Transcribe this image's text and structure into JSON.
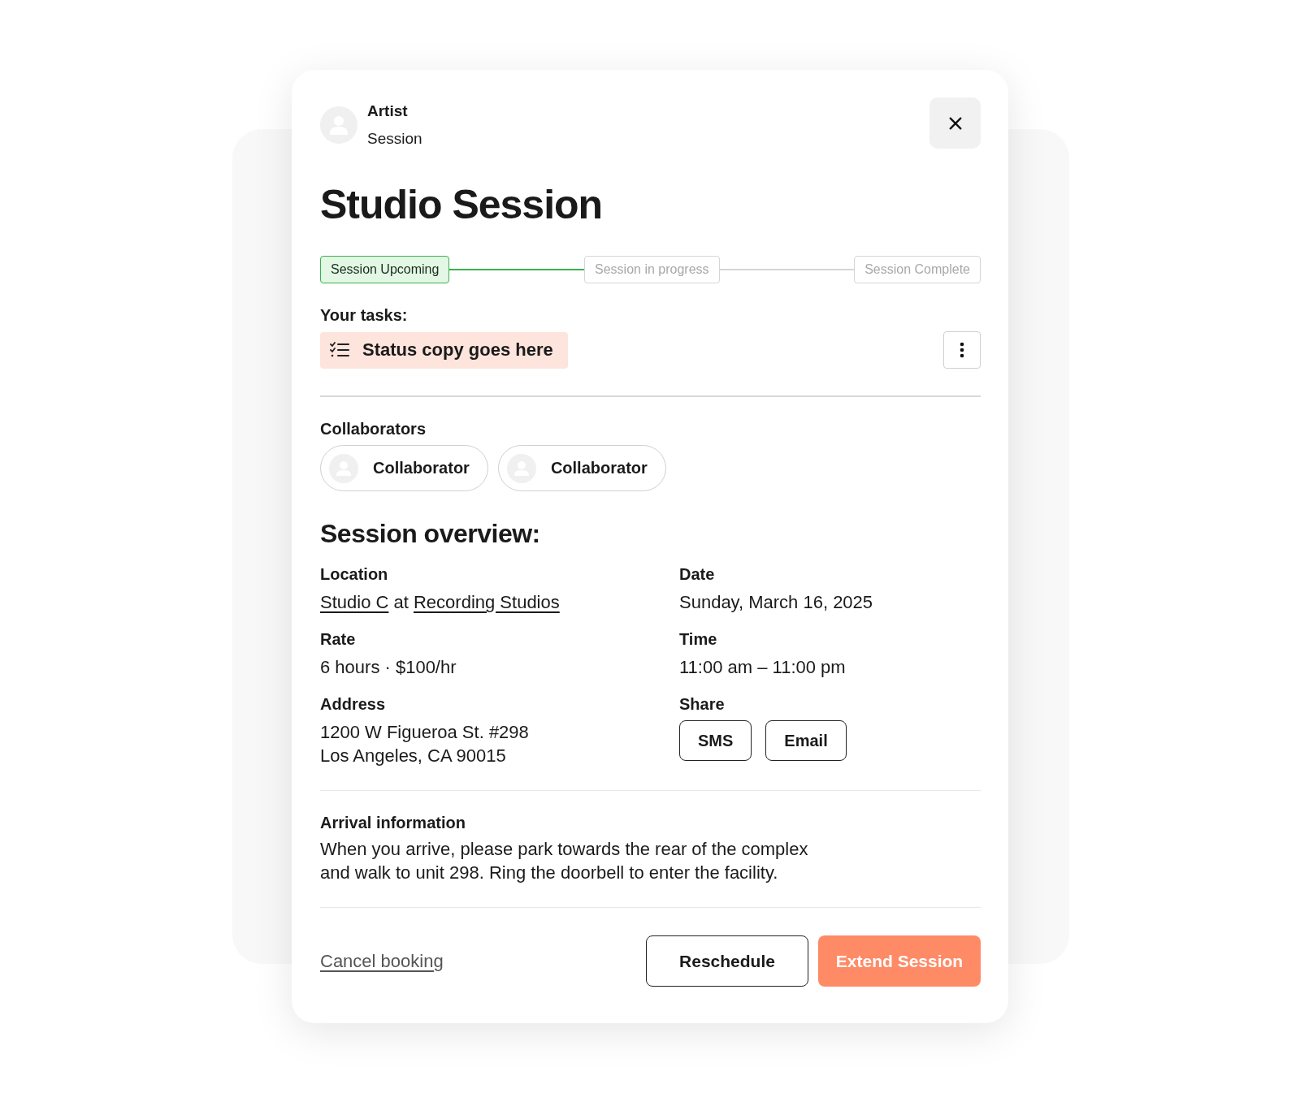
{
  "header": {
    "name": "Artist",
    "subtitle": "Session"
  },
  "title": "Studio Session",
  "steps": [
    {
      "label": "Session Upcoming",
      "active": true
    },
    {
      "label": "Session in progress",
      "active": false
    },
    {
      "label": "Session Complete",
      "active": false
    }
  ],
  "tasks": {
    "label": "Your tasks:",
    "status": "Status copy goes here"
  },
  "collaborators": {
    "label": "Collaborators",
    "items": [
      {
        "name": "Collaborator"
      },
      {
        "name": "Collaborator"
      }
    ]
  },
  "overview": {
    "title": "Session overview:",
    "location": {
      "label": "Location",
      "parts": [
        {
          "kind": "link",
          "text": "Studio C"
        },
        {
          "kind": "text",
          "text": " at "
        },
        {
          "kind": "link",
          "text": "Recording Studios"
        }
      ]
    },
    "date": {
      "label": "Date",
      "value": "Sunday, March 16, 2025"
    },
    "rate": {
      "label": "Rate",
      "value": "6 hours · $100/hr"
    },
    "time": {
      "label": "Time",
      "value": "11:00 am – 11:00 pm"
    },
    "address": {
      "label": "Address",
      "lines": [
        "1200 W Figueroa St. #298",
        "Los Angeles, CA 90015"
      ]
    },
    "share": {
      "label": "Share",
      "buttons": [
        "SMS",
        "Email"
      ]
    }
  },
  "arrival": {
    "label": "Arrival information",
    "lines": [
      "When you arrive, please park towards the rear of the complex",
      "and walk to unit 298. Ring the doorbell to enter the facility."
    ]
  },
  "footer": {
    "cancel": "Cancel booking",
    "secondary": "Reschedule",
    "primary": "Extend Session"
  }
}
